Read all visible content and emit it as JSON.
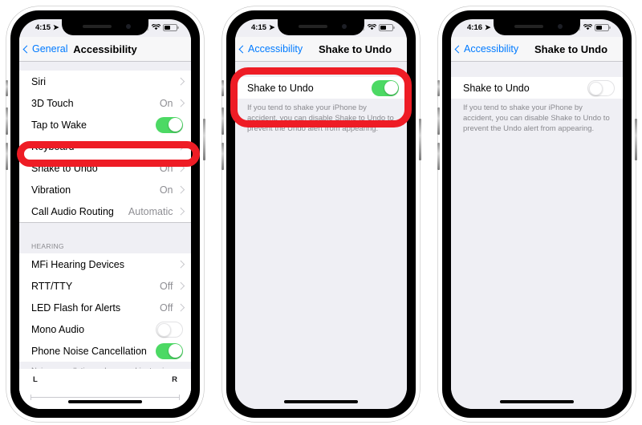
{
  "accent": {
    "link_blue": "#007aff",
    "toggle_green": "#4cd964",
    "annotation_red": "#ee1c25",
    "value_gray": "#8e8e93"
  },
  "phones": [
    {
      "id": "phone-accessibility-list",
      "status_bar": {
        "time": "4:15",
        "location_icon": "location-arrow-icon",
        "signal_icon": "cellular-signal-icon",
        "wifi_icon": "wifi-icon",
        "battery_icon": "battery-icon"
      },
      "nav": {
        "back_label": "General",
        "back_icon": "chevron-left-icon",
        "title": "Accessibility"
      },
      "groups": [
        {
          "header": null,
          "rows": [
            {
              "label": "Siri",
              "value": null,
              "accessory": "chevron"
            },
            {
              "label": "3D Touch",
              "value": "On",
              "accessory": "chevron"
            },
            {
              "label": "Tap to Wake",
              "value": null,
              "accessory": "toggle-on"
            },
            {
              "label": "Keyboard",
              "value": null,
              "accessory": "chevron"
            },
            {
              "label": "Shake to Undo",
              "value": "On",
              "accessory": "chevron",
              "highlighted": true
            },
            {
              "label": "Vibration",
              "value": "On",
              "accessory": "chevron"
            },
            {
              "label": "Call Audio Routing",
              "value": "Automatic",
              "accessory": "chevron"
            }
          ]
        },
        {
          "header": "HEARING",
          "rows": [
            {
              "label": "MFi Hearing Devices",
              "value": null,
              "accessory": "chevron"
            },
            {
              "label": "RTT/TTY",
              "value": "Off",
              "accessory": "chevron"
            },
            {
              "label": "LED Flash for Alerts",
              "value": "Off",
              "accessory": "chevron"
            },
            {
              "label": "Mono Audio",
              "value": null,
              "accessory": "toggle-off"
            },
            {
              "label": "Phone Noise Cancellation",
              "value": null,
              "accessory": "toggle-on"
            }
          ]
        }
      ],
      "footnote": "Noise cancellation reduces ambient noise on phone calls when you are holding the receiver to your ear.",
      "balance": {
        "left_label": "L",
        "right_label": "R"
      },
      "annotation": {
        "shape": "oval",
        "target": "Shake to Undo"
      }
    },
    {
      "id": "phone-shake-to-undo-on",
      "status_bar": {
        "time": "4:15",
        "location_icon": "location-arrow-icon",
        "signal_icon": "cellular-signal-icon",
        "wifi_icon": "wifi-icon",
        "battery_icon": "battery-icon"
      },
      "nav": {
        "back_label": "Accessibility",
        "back_icon": "chevron-left-icon",
        "title": "Shake to Undo"
      },
      "setting": {
        "label": "Shake to Undo",
        "state": "on",
        "footnote": "If you tend to shake your iPhone by accident, you can disable Shake to Undo to prevent the Undo alert from appearing."
      },
      "annotation": {
        "shape": "rounded-rect",
        "target": "Shake to Undo toggle and description"
      }
    },
    {
      "id": "phone-shake-to-undo-off",
      "status_bar": {
        "time": "4:16",
        "location_icon": "location-arrow-icon",
        "signal_icon": "cellular-signal-icon",
        "wifi_icon": "wifi-icon",
        "battery_icon": "battery-icon"
      },
      "nav": {
        "back_label": "Accessibility",
        "back_icon": "chevron-left-icon",
        "title": "Shake to Undo"
      },
      "setting": {
        "label": "Shake to Undo",
        "state": "off",
        "footnote": "If you tend to shake your iPhone by accident, you can disable Shake to Undo to prevent the Undo alert from appearing."
      },
      "annotation": null
    }
  ]
}
